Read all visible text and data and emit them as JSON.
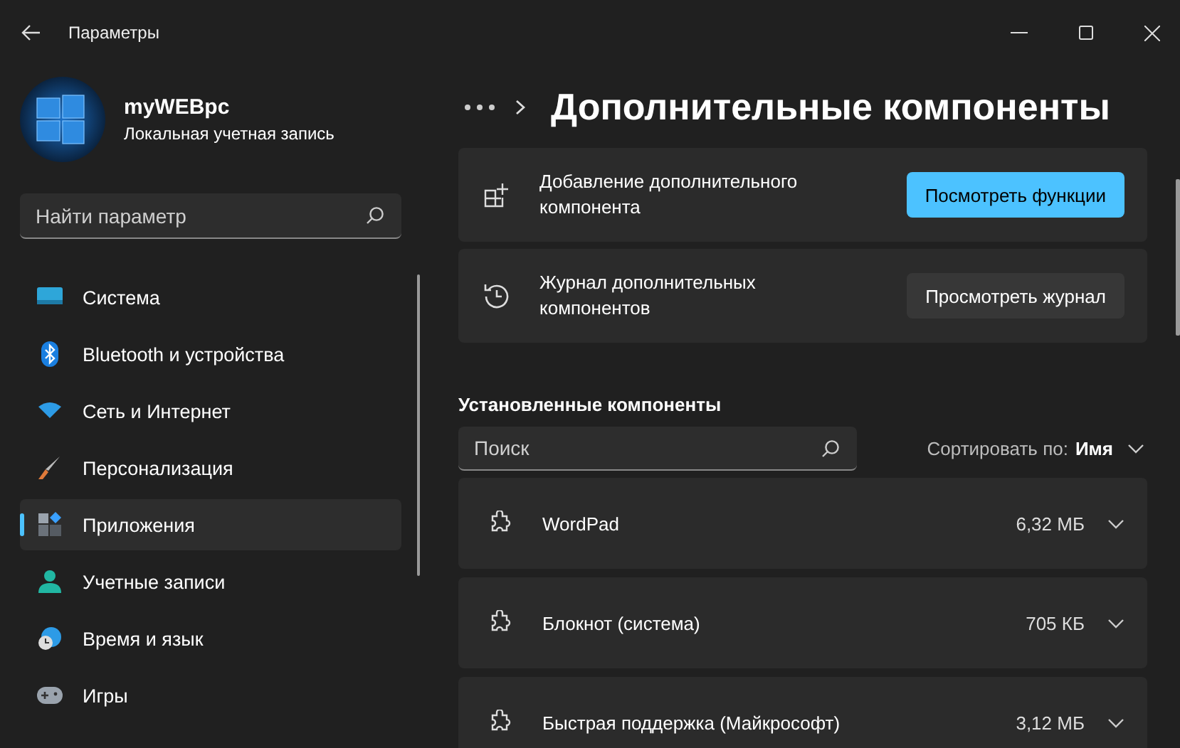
{
  "window": {
    "title": "Параметры"
  },
  "account": {
    "name": "myWEBpc",
    "type": "Локальная учетная запись"
  },
  "sidebar": {
    "search": {
      "placeholder": "Найти параметр"
    },
    "items": [
      {
        "label": "Система",
        "selected": false
      },
      {
        "label": "Bluetooth и устройства",
        "selected": false
      },
      {
        "label": "Сеть и Интернет",
        "selected": false
      },
      {
        "label": "Персонализация",
        "selected": false
      },
      {
        "label": "Приложения",
        "selected": true
      },
      {
        "label": "Учетные записи",
        "selected": false
      },
      {
        "label": "Время и язык",
        "selected": false
      },
      {
        "label": "Игры",
        "selected": false
      }
    ]
  },
  "page": {
    "title": "Дополнительные компоненты"
  },
  "actions": [
    {
      "label": "Добавление дополнительного компонента",
      "button": "Посмотреть функции",
      "kind": "primary"
    },
    {
      "label": "Журнал дополнительных компонентов",
      "button": "Просмотреть журнал",
      "kind": "secondary"
    }
  ],
  "installed": {
    "heading": "Установленные компоненты",
    "search": {
      "placeholder": "Поиск"
    },
    "sort": {
      "label": "Сортировать по:",
      "value": "Имя"
    },
    "items": [
      {
        "name": "WordPad",
        "size": "6,32 МБ"
      },
      {
        "name": "Блокнот (система)",
        "size": "705 КБ"
      },
      {
        "name": "Быстрая поддержка (Майкрософт)",
        "size": "3,12 МБ"
      }
    ]
  }
}
